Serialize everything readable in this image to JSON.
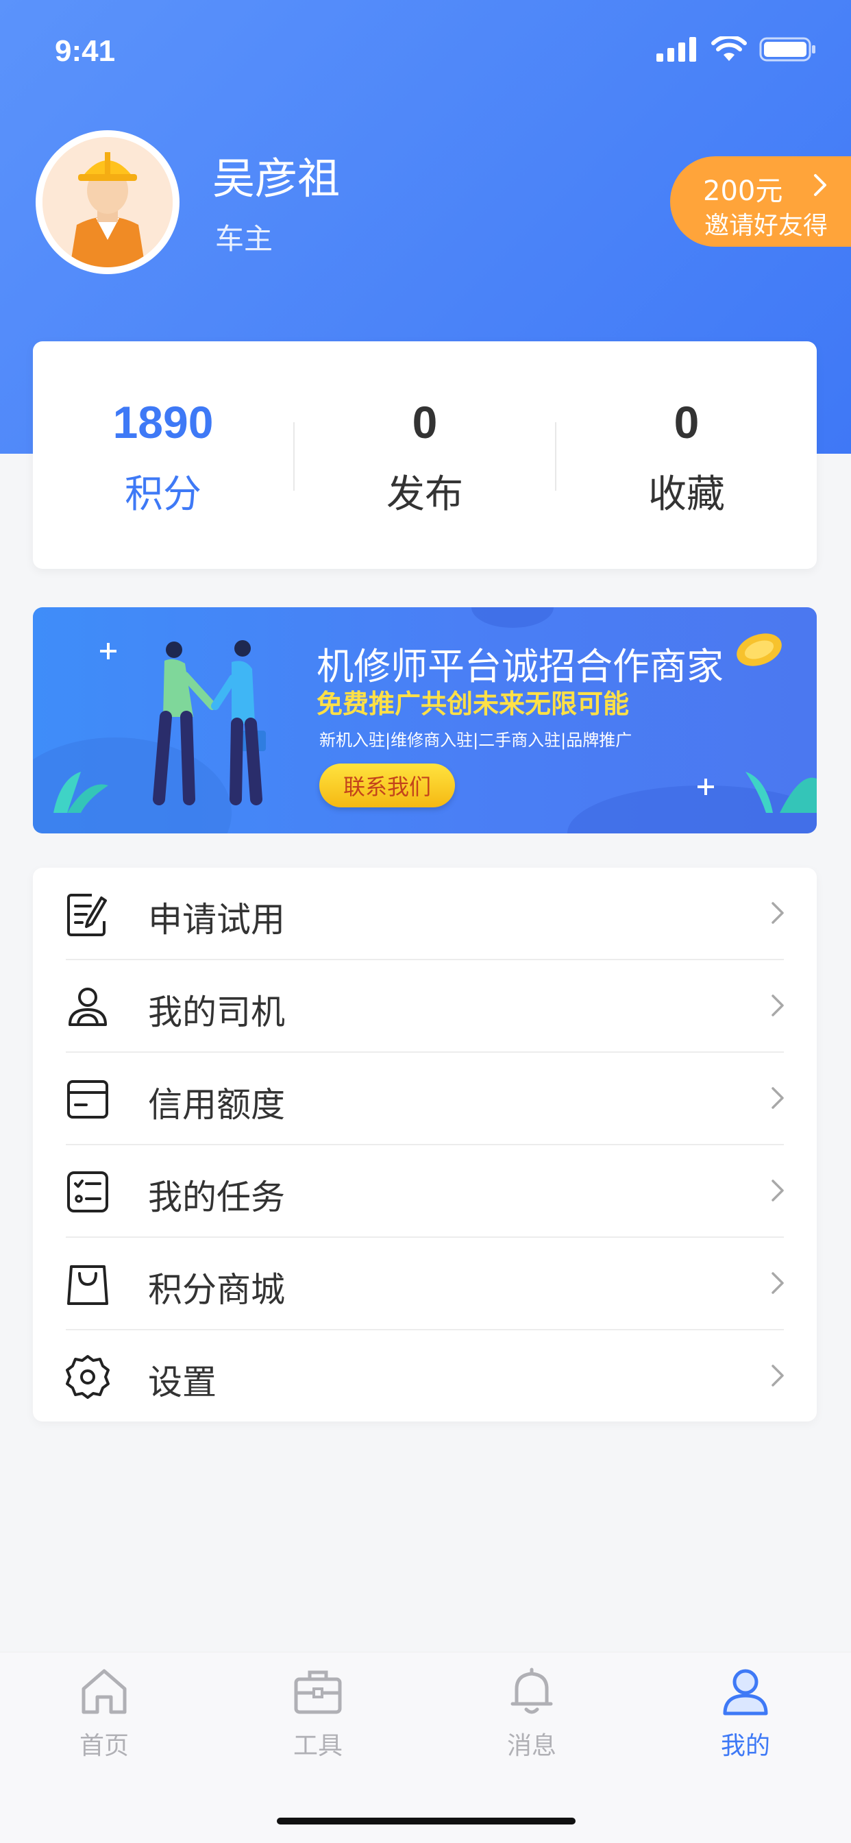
{
  "status_bar": {
    "time": "9:41"
  },
  "profile": {
    "name": "吴彦祖",
    "role": "车主",
    "invite": {
      "amount": "200元",
      "text": "邀请好友得"
    }
  },
  "stats": [
    {
      "value": "1890",
      "label": "积分"
    },
    {
      "value": "0",
      "label": "发布"
    },
    {
      "value": "0",
      "label": "收藏"
    }
  ],
  "banner": {
    "title": "机修师平台诚招合作商家",
    "subtitle": "免费推广共创未来无限可能",
    "tags": "新机入驻|维修商入驻|二手商入驻|品牌推广",
    "button": "联系我们"
  },
  "menu": [
    {
      "label": "申请试用",
      "icon": "apply-edit-icon"
    },
    {
      "label": "我的司机",
      "icon": "driver-person-icon"
    },
    {
      "label": "信用额度",
      "icon": "credit-card-icon"
    },
    {
      "label": "我的任务",
      "icon": "task-checklist-icon"
    },
    {
      "label": "积分商城",
      "icon": "shopping-bag-icon"
    },
    {
      "label": "设置",
      "icon": "gear-icon"
    }
  ],
  "tabbar": [
    {
      "label": "首页",
      "icon": "home-icon"
    },
    {
      "label": "工具",
      "icon": "toolbox-icon"
    },
    {
      "label": "消息",
      "icon": "bell-icon"
    },
    {
      "label": "我的",
      "icon": "user-icon",
      "active": true
    }
  ],
  "colors": {
    "primary": "#3e79f6",
    "accent_orange": "#ffa43a",
    "banner_yellow": "#ffe046"
  }
}
